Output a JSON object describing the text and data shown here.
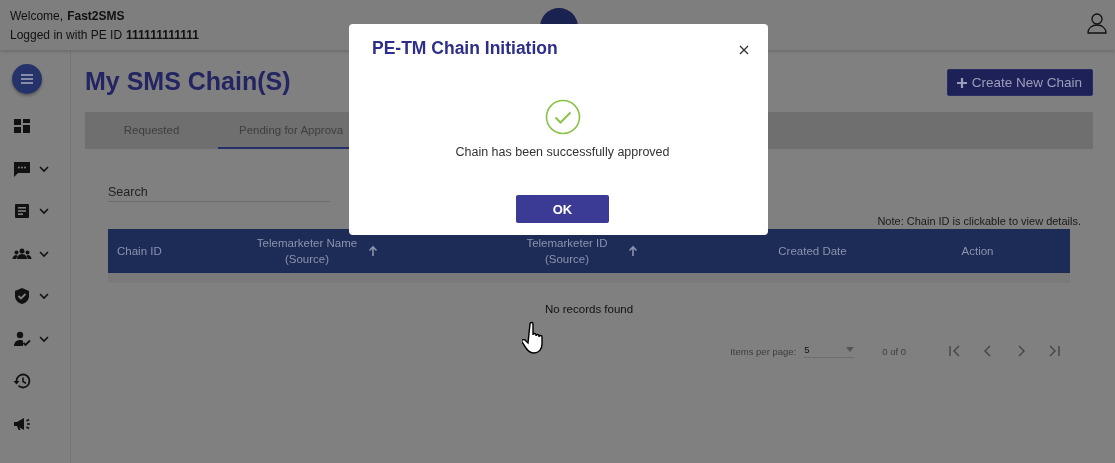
{
  "header": {
    "welcome_label": "Welcome,",
    "user_name": "Fast2SMS",
    "login_label": "Logged in with PE ID",
    "pe_id": "111111111111"
  },
  "sidebar": {
    "items": [
      {
        "expandable": false
      },
      {
        "expandable": true
      },
      {
        "expandable": true
      },
      {
        "expandable": true
      },
      {
        "expandable": true
      },
      {
        "expandable": true
      },
      {
        "expandable": false
      },
      {
        "expandable": false
      }
    ]
  },
  "page_title": "My SMS Chain(S)",
  "create_button": "Create New Chain",
  "tabs": [
    {
      "label": "Requested",
      "selected": false
    },
    {
      "label": "Pending for Approva",
      "selected": true
    }
  ],
  "search": {
    "placeholder": "Search"
  },
  "note": "Note: Chain ID is clickable to view details.",
  "table": {
    "columns": [
      {
        "label": "Chain ID",
        "sort_arrow": false
      },
      {
        "label": "Telemarketer Name (Source)",
        "sort_arrow": true
      },
      {
        "label": "Telemarketer ID (Source)",
        "sort_arrow": true
      },
      {
        "label": "Created Date",
        "sort_arrow": false
      },
      {
        "label": "Action",
        "sort_arrow": false
      }
    ],
    "empty_text": "No records found"
  },
  "paginator": {
    "label": "Items per page:",
    "page_size": "5",
    "range": "0 of 0"
  },
  "dialog": {
    "title": "PE-TM Chain Initiation",
    "message": "Chain has been successfully approved",
    "button": "OK"
  }
}
